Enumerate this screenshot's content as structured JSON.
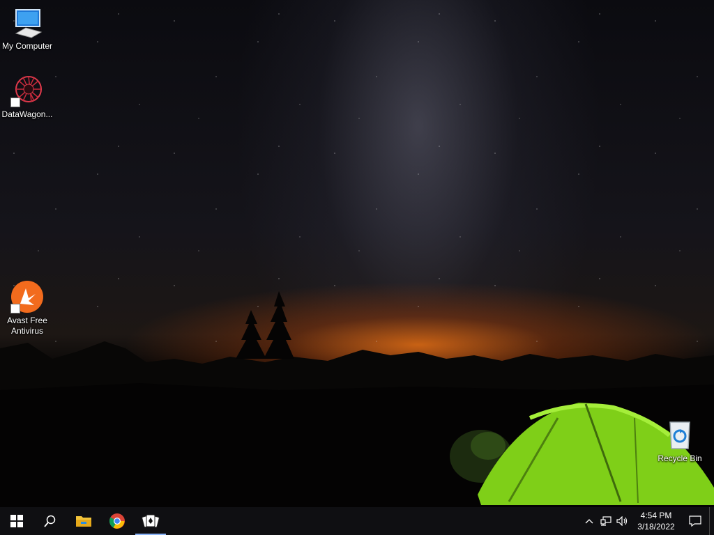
{
  "desktop": {
    "icons": [
      {
        "label": "My Computer",
        "icon": "monitor-icon"
      },
      {
        "label": "DataWagon...",
        "icon": "datawagon-icon"
      },
      {
        "label": "Avast Free Antivirus",
        "icon": "avast-icon"
      },
      {
        "label": "Recycle Bin",
        "icon": "recycle-bin-icon"
      }
    ]
  },
  "taskbar": {
    "buttons": [
      {
        "name": "start",
        "icon": "windows-logo-icon"
      },
      {
        "name": "search",
        "icon": "search-icon"
      },
      {
        "name": "file-explorer",
        "icon": "folder-icon"
      },
      {
        "name": "chrome",
        "icon": "chrome-icon"
      },
      {
        "name": "solitaire",
        "icon": "cards-icon",
        "active": true
      }
    ],
    "tray": {
      "icons": [
        "chevron-up-icon",
        "network-icon",
        "volume-icon"
      ],
      "time": "4:54 PM",
      "date": "3/18/2022"
    }
  },
  "colors": {
    "taskbar_bg": "#0f0f12",
    "active_indicator": "#8ab4f8",
    "avast_orange": "#f26b1d",
    "tent_green": "#86d61a"
  }
}
